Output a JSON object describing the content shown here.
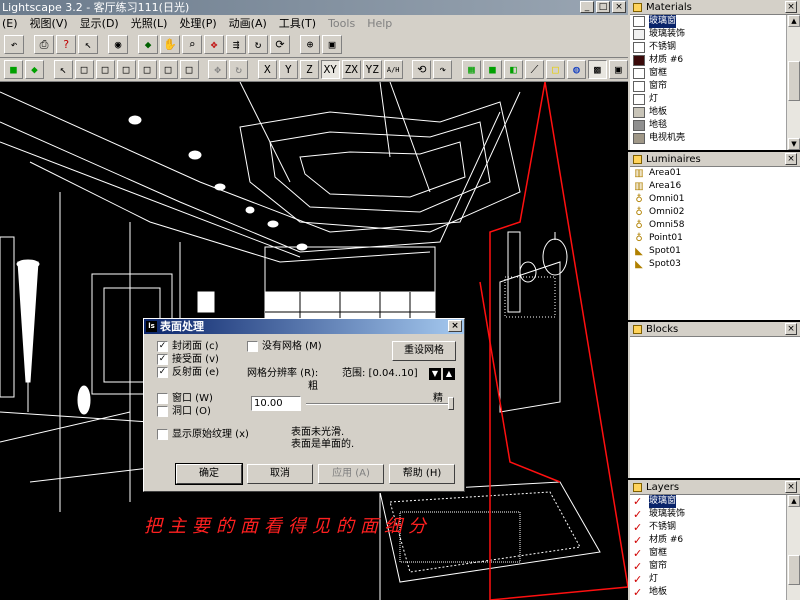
{
  "app": {
    "title": "Lightscape 3.2 - 客厅练习111(日光)",
    "window_buttons": [
      "_",
      "□",
      "×"
    ]
  },
  "menu": [
    {
      "label": "(E)",
      "disabled": false
    },
    {
      "label": "视图(V)",
      "disabled": false
    },
    {
      "label": "显示(D)",
      "disabled": false
    },
    {
      "label": "光照(L)",
      "disabled": false
    },
    {
      "label": "处理(P)",
      "disabled": false
    },
    {
      "label": "动画(A)",
      "disabled": false
    },
    {
      "label": "工具(T)",
      "disabled": false
    },
    {
      "label": "Tools",
      "disabled": true
    },
    {
      "label": "Help",
      "disabled": true
    }
  ],
  "toolbar2_text_buttons": [
    "X",
    "Y",
    "Z",
    "XY",
    "ZX",
    "YZ",
    "A/H"
  ],
  "viewport": {
    "caption": "把主要的面看得见的面细分"
  },
  "materials": {
    "title": "Materials",
    "items": [
      {
        "label": "玻璃窗",
        "color": "#ffffff",
        "selected": true
      },
      {
        "label": "玻璃装饰",
        "color": "#f0f0f0",
        "selected": false
      },
      {
        "label": "不锈钢",
        "color": "#ffffff",
        "selected": false
      },
      {
        "label": "材质 #6",
        "color": "#3a0a0a",
        "selected": false
      },
      {
        "label": "窗框",
        "color": "#ffffff",
        "selected": false
      },
      {
        "label": "窗帘",
        "color": "#ffffff",
        "selected": false
      },
      {
        "label": "灯",
        "color": "#ffffff",
        "selected": false
      },
      {
        "label": "地板",
        "color": "#c8c4b8",
        "selected": false
      },
      {
        "label": "地毯",
        "color": "#909090",
        "selected": false
      },
      {
        "label": "电视机壳",
        "color": "#a09888",
        "selected": false
      }
    ]
  },
  "luminaires": {
    "title": "Luminaires",
    "items": [
      "Area01",
      "Area16",
      "Omni01",
      "Omni02",
      "Omni58",
      "Point01",
      "Spot01",
      "Spot03"
    ]
  },
  "blocks": {
    "title": "Blocks",
    "items": []
  },
  "layers": {
    "title": "Layers",
    "items": [
      {
        "label": "玻璃窗",
        "selected": true
      },
      {
        "label": "玻璃装饰",
        "selected": false
      },
      {
        "label": "不锈钢",
        "selected": false
      },
      {
        "label": "材质 #6",
        "selected": false
      },
      {
        "label": "窗框",
        "selected": false
      },
      {
        "label": "窗帘",
        "selected": false
      },
      {
        "label": "灯",
        "selected": false
      },
      {
        "label": "地板",
        "selected": false
      }
    ]
  },
  "dialog": {
    "title": "表面处理",
    "close": "×",
    "cb_closed": {
      "label": "封闭面 (c)",
      "checked": true
    },
    "cb_receive": {
      "label": "接受面 (v)",
      "checked": true
    },
    "cb_reflect": {
      "label": "反射面 (e)",
      "checked": true
    },
    "cb_nomesh": {
      "label": "没有网格 (M)",
      "checked": false
    },
    "cb_window": {
      "label": "窗口 (W)",
      "checked": false
    },
    "cb_opening": {
      "label": "洞口 (O)",
      "checked": false
    },
    "cb_texture": {
      "label": "显示原始纹理 (x)",
      "checked": false
    },
    "reset_mesh_button": "重设网格",
    "mesh_res_label": "网格分辨率 (R):",
    "range_label": "范围: [0.04..10]",
    "coarse": "粗",
    "fine": "精",
    "mesh_value": "10.00",
    "slider_position": 1.0,
    "note_line1": "表面未光滑.",
    "note_line2": "表面是单面的.",
    "ok_button": "确定",
    "cancel_button": "取消",
    "apply_button": "应用 (A)",
    "help_button": "帮助 (H)"
  }
}
